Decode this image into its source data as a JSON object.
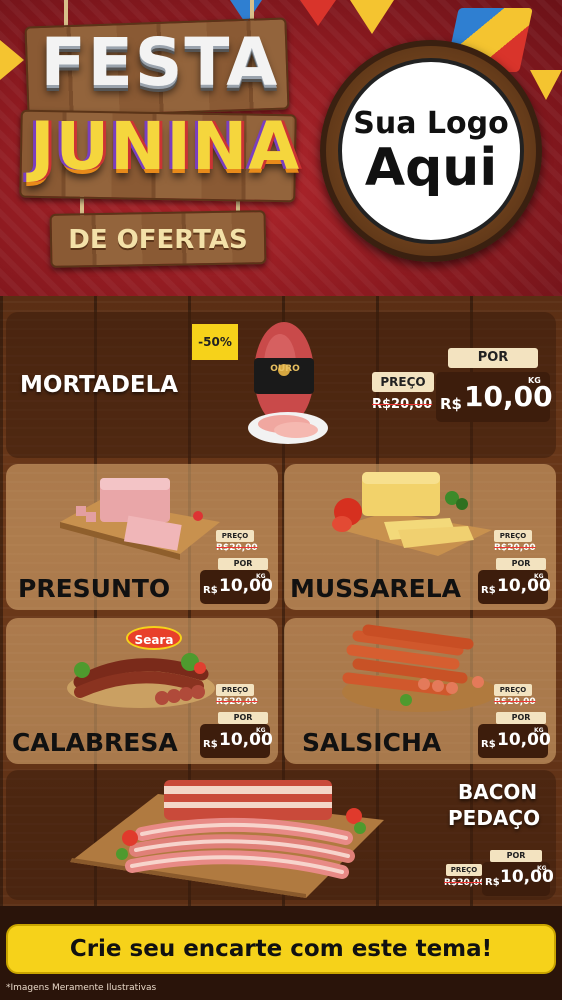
{
  "header": {
    "title_line1": "FESTA",
    "title_line2": "JUNINA",
    "title_line3": "DE OFERTAS",
    "logo_line1": "Sua Logo",
    "logo_line2": "Aqui"
  },
  "featured": {
    "name": "MORTADELA",
    "discount_badge": "-50%",
    "brand_label": "OURO",
    "preco_label": "PREÇO",
    "old_price": "R$20,00",
    "por_label": "POR",
    "currency": "R$",
    "new_price": "10,00",
    "unit": "KG"
  },
  "products": [
    {
      "name": "PRESUNTO",
      "preco_label": "PREÇO",
      "old_price": "R$20,00",
      "por_label": "POR",
      "currency": "R$",
      "new_price": "10,00",
      "unit": "KG"
    },
    {
      "name": "MUSSARELA",
      "preco_label": "PREÇO",
      "old_price": "R$20,00",
      "por_label": "POR",
      "currency": "R$",
      "new_price": "10,00",
      "unit": "KG"
    },
    {
      "name": "CALABRESA",
      "brand_label": "Seara",
      "preco_label": "PREÇO",
      "old_price": "R$20,00",
      "por_label": "POR",
      "currency": "R$",
      "new_price": "10,00",
      "unit": "KG"
    },
    {
      "name": "SALSICHA",
      "preco_label": "PREÇO",
      "old_price": "R$20,00",
      "por_label": "POR",
      "currency": "R$",
      "new_price": "10,00",
      "unit": "KG"
    }
  ],
  "bacon": {
    "name_line1": "BACON",
    "name_line2": "PEDAÇO",
    "preco_label": "PREÇO",
    "old_price": "R$20,00",
    "por_label": "POR",
    "currency": "R$",
    "new_price": "10,00",
    "unit": "KG"
  },
  "footer": {
    "cta": "Crie seu encarte com este tema!",
    "disclaimer": "*Imagens Meramente Ilustrativas"
  }
}
